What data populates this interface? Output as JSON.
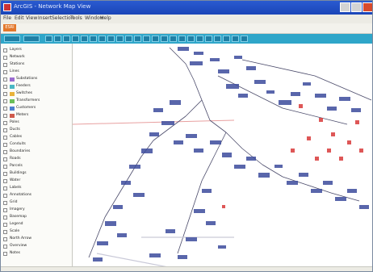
{
  "window": {
    "title": "ArcGIS - Network Map View",
    "accent": "#2fa6c9",
    "titlebar_color": "#1a45b8"
  },
  "menu": {
    "items": [
      "File",
      "Edit",
      "View",
      "Insert",
      "Selection",
      "Tools",
      "Window",
      "Help"
    ]
  },
  "address": {
    "brand": "ESRI",
    "text": ""
  },
  "toolbar": {
    "buttons": [
      "",
      "",
      "",
      "",
      "",
      "",
      "",
      "",
      "",
      "",
      "",
      "",
      "",
      "",
      "",
      "",
      "",
      "",
      "",
      "",
      "",
      "",
      "",
      "",
      ""
    ]
  },
  "sidebar": {
    "rows": [
      {
        "label": "Layers"
      },
      {
        "label": "Network"
      },
      {
        "label": "Stations"
      },
      {
        "label": "Lines"
      },
      {
        "label": "Substations"
      },
      {
        "label": "Feeders"
      },
      {
        "label": "Switches"
      },
      {
        "label": "Transformers"
      },
      {
        "label": "Customers"
      },
      {
        "label": "Meters"
      },
      {
        "label": "Poles"
      },
      {
        "label": "Ducts"
      },
      {
        "label": "Cables"
      },
      {
        "label": "Conduits"
      },
      {
        "label": "Boundaries"
      },
      {
        "label": "Roads"
      },
      {
        "label": "Parcels"
      },
      {
        "label": "Buildings"
      },
      {
        "label": "Water"
      },
      {
        "label": "Labels"
      },
      {
        "label": "Annotations"
      },
      {
        "label": "Grid"
      },
      {
        "label": "Imagery"
      },
      {
        "label": "Basemap"
      },
      {
        "label": "Legend"
      },
      {
        "label": "Scale"
      },
      {
        "label": "North Arrow"
      },
      {
        "label": "Overview"
      },
      {
        "label": "Notes"
      }
    ]
  },
  "map": {
    "node_color": "#3c4b9c",
    "highlight_color": "#d83a3a",
    "line_color": "#4a4a6a"
  }
}
